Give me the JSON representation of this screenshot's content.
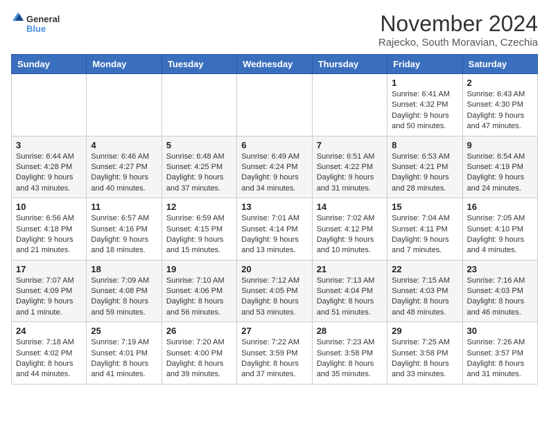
{
  "logo": {
    "general": "General",
    "blue": "Blue"
  },
  "title": "November 2024",
  "subtitle": "Rajecko, South Moravian, Czechia",
  "days_of_week": [
    "Sunday",
    "Monday",
    "Tuesday",
    "Wednesday",
    "Thursday",
    "Friday",
    "Saturday"
  ],
  "weeks": [
    [
      {
        "day": "",
        "info": ""
      },
      {
        "day": "",
        "info": ""
      },
      {
        "day": "",
        "info": ""
      },
      {
        "day": "",
        "info": ""
      },
      {
        "day": "",
        "info": ""
      },
      {
        "day": "1",
        "info": "Sunrise: 6:41 AM\nSunset: 4:32 PM\nDaylight: 9 hours and 50 minutes."
      },
      {
        "day": "2",
        "info": "Sunrise: 6:43 AM\nSunset: 4:30 PM\nDaylight: 9 hours and 47 minutes."
      }
    ],
    [
      {
        "day": "3",
        "info": "Sunrise: 6:44 AM\nSunset: 4:28 PM\nDaylight: 9 hours and 43 minutes."
      },
      {
        "day": "4",
        "info": "Sunrise: 6:46 AM\nSunset: 4:27 PM\nDaylight: 9 hours and 40 minutes."
      },
      {
        "day": "5",
        "info": "Sunrise: 6:48 AM\nSunset: 4:25 PM\nDaylight: 9 hours and 37 minutes."
      },
      {
        "day": "6",
        "info": "Sunrise: 6:49 AM\nSunset: 4:24 PM\nDaylight: 9 hours and 34 minutes."
      },
      {
        "day": "7",
        "info": "Sunrise: 6:51 AM\nSunset: 4:22 PM\nDaylight: 9 hours and 31 minutes."
      },
      {
        "day": "8",
        "info": "Sunrise: 6:53 AM\nSunset: 4:21 PM\nDaylight: 9 hours and 28 minutes."
      },
      {
        "day": "9",
        "info": "Sunrise: 6:54 AM\nSunset: 4:19 PM\nDaylight: 9 hours and 24 minutes."
      }
    ],
    [
      {
        "day": "10",
        "info": "Sunrise: 6:56 AM\nSunset: 4:18 PM\nDaylight: 9 hours and 21 minutes."
      },
      {
        "day": "11",
        "info": "Sunrise: 6:57 AM\nSunset: 4:16 PM\nDaylight: 9 hours and 18 minutes."
      },
      {
        "day": "12",
        "info": "Sunrise: 6:59 AM\nSunset: 4:15 PM\nDaylight: 9 hours and 15 minutes."
      },
      {
        "day": "13",
        "info": "Sunrise: 7:01 AM\nSunset: 4:14 PM\nDaylight: 9 hours and 13 minutes."
      },
      {
        "day": "14",
        "info": "Sunrise: 7:02 AM\nSunset: 4:12 PM\nDaylight: 9 hours and 10 minutes."
      },
      {
        "day": "15",
        "info": "Sunrise: 7:04 AM\nSunset: 4:11 PM\nDaylight: 9 hours and 7 minutes."
      },
      {
        "day": "16",
        "info": "Sunrise: 7:05 AM\nSunset: 4:10 PM\nDaylight: 9 hours and 4 minutes."
      }
    ],
    [
      {
        "day": "17",
        "info": "Sunrise: 7:07 AM\nSunset: 4:09 PM\nDaylight: 9 hours and 1 minute."
      },
      {
        "day": "18",
        "info": "Sunrise: 7:09 AM\nSunset: 4:08 PM\nDaylight: 8 hours and 59 minutes."
      },
      {
        "day": "19",
        "info": "Sunrise: 7:10 AM\nSunset: 4:06 PM\nDaylight: 8 hours and 56 minutes."
      },
      {
        "day": "20",
        "info": "Sunrise: 7:12 AM\nSunset: 4:05 PM\nDaylight: 8 hours and 53 minutes."
      },
      {
        "day": "21",
        "info": "Sunrise: 7:13 AM\nSunset: 4:04 PM\nDaylight: 8 hours and 51 minutes."
      },
      {
        "day": "22",
        "info": "Sunrise: 7:15 AM\nSunset: 4:03 PM\nDaylight: 8 hours and 48 minutes."
      },
      {
        "day": "23",
        "info": "Sunrise: 7:16 AM\nSunset: 4:03 PM\nDaylight: 8 hours and 46 minutes."
      }
    ],
    [
      {
        "day": "24",
        "info": "Sunrise: 7:18 AM\nSunset: 4:02 PM\nDaylight: 8 hours and 44 minutes."
      },
      {
        "day": "25",
        "info": "Sunrise: 7:19 AM\nSunset: 4:01 PM\nDaylight: 8 hours and 41 minutes."
      },
      {
        "day": "26",
        "info": "Sunrise: 7:20 AM\nSunset: 4:00 PM\nDaylight: 8 hours and 39 minutes."
      },
      {
        "day": "27",
        "info": "Sunrise: 7:22 AM\nSunset: 3:59 PM\nDaylight: 8 hours and 37 minutes."
      },
      {
        "day": "28",
        "info": "Sunrise: 7:23 AM\nSunset: 3:58 PM\nDaylight: 8 hours and 35 minutes."
      },
      {
        "day": "29",
        "info": "Sunrise: 7:25 AM\nSunset: 3:58 PM\nDaylight: 8 hours and 33 minutes."
      },
      {
        "day": "30",
        "info": "Sunrise: 7:26 AM\nSunset: 3:57 PM\nDaylight: 8 hours and 31 minutes."
      }
    ]
  ]
}
